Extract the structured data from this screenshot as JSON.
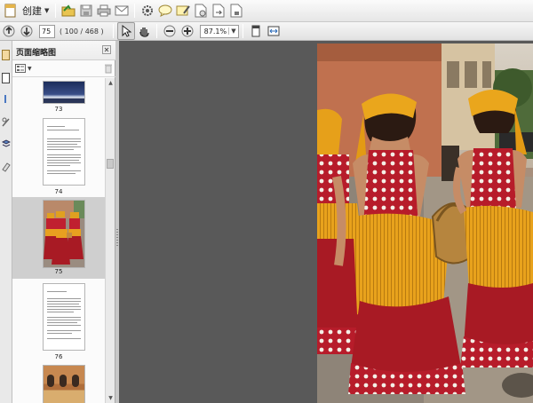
{
  "toolbar": {
    "create_label": "创建",
    "page_current": "75",
    "page_count": "( 100 / 468 )",
    "zoom": "87.1%"
  },
  "panel": {
    "title": "页面缩略图"
  },
  "thumbnails": [
    {
      "label": "73"
    },
    {
      "label": "74"
    },
    {
      "label": "75"
    },
    {
      "label": "76"
    }
  ],
  "colors": {
    "document_bg": "#595959",
    "panel_selected": "#cfcfcf",
    "dress_red": "#b71c2a",
    "scarf_yellow": "#e8a21c"
  },
  "icons": [
    "open-folder-icon",
    "save-icon",
    "print-icon",
    "email-icon",
    "gear-icon",
    "comment-icon",
    "annotate-icon",
    "sign-icon",
    "export-icon",
    "secure-icon",
    "prev-page-icon",
    "next-page-icon",
    "select-arrow-icon",
    "hand-tool-icon",
    "zoom-out-icon",
    "zoom-in-icon",
    "fit-page-icon",
    "fit-width-icon"
  ]
}
